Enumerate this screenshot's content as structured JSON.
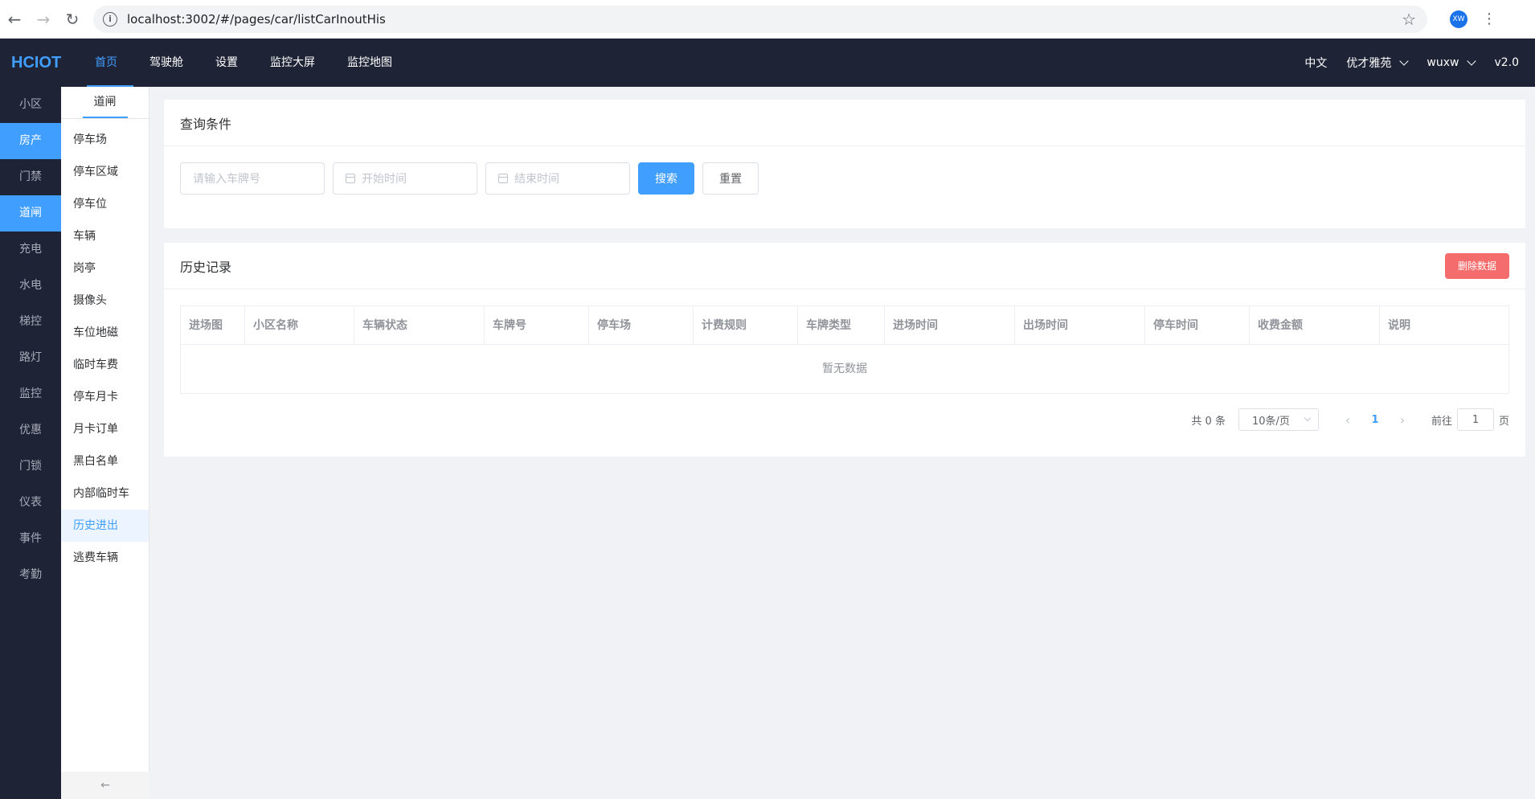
{
  "browser": {
    "url": "localhost:3002/#/pages/car/listCarInoutHis",
    "profile_initials": "XW"
  },
  "header": {
    "logo": "HCIOT",
    "nav": [
      {
        "label": "首页",
        "active": true
      },
      {
        "label": "驾驶舱"
      },
      {
        "label": "设置"
      },
      {
        "label": "监控大屏"
      },
      {
        "label": "监控地图"
      }
    ],
    "language": "中文",
    "community": "优才雅苑",
    "user": "wuxw",
    "version": "v2.0"
  },
  "rail": {
    "items": [
      "小区",
      "房产",
      "门禁",
      "道闸",
      "充电",
      "水电",
      "梯控",
      "路灯",
      "监控",
      "优惠",
      "门锁",
      "仪表",
      "事件",
      "考勤"
    ]
  },
  "submenu": {
    "title": "道闸",
    "items": [
      "停车场",
      "停车区域",
      "停车位",
      "车辆",
      "岗亭",
      "摄像头",
      "车位地磁",
      "临时车费",
      "停车月卡",
      "月卡订单",
      "黑白名单",
      "内部临时车",
      "历史进出",
      "逃费车辆"
    ],
    "collapse_glyph": "←"
  },
  "query": {
    "title": "查询条件",
    "plate_placeholder": "请输入车牌号",
    "start_placeholder": "开始时间",
    "end_placeholder": "结束时间",
    "search_label": "搜索",
    "reset_label": "重置"
  },
  "history": {
    "title": "历史记录",
    "delete_label": "删除数据",
    "columns": [
      "进场图",
      "小区名称",
      "车辆状态",
      "车牌号",
      "停车场",
      "计费规则",
      "车牌类型",
      "进场时间",
      "出场时间",
      "停车时间",
      "收费金额",
      "说明"
    ],
    "empty_text": "暂无数据"
  },
  "pagination": {
    "total": "共 0 条",
    "page_size": "10条/页",
    "current_page": "1",
    "goto_prefix": "前往",
    "goto_value": "1",
    "goto_suffix": "页"
  },
  "colors": {
    "primary": "#409eff",
    "danger": "#f56c6c",
    "header_bg": "#1f2336"
  }
}
